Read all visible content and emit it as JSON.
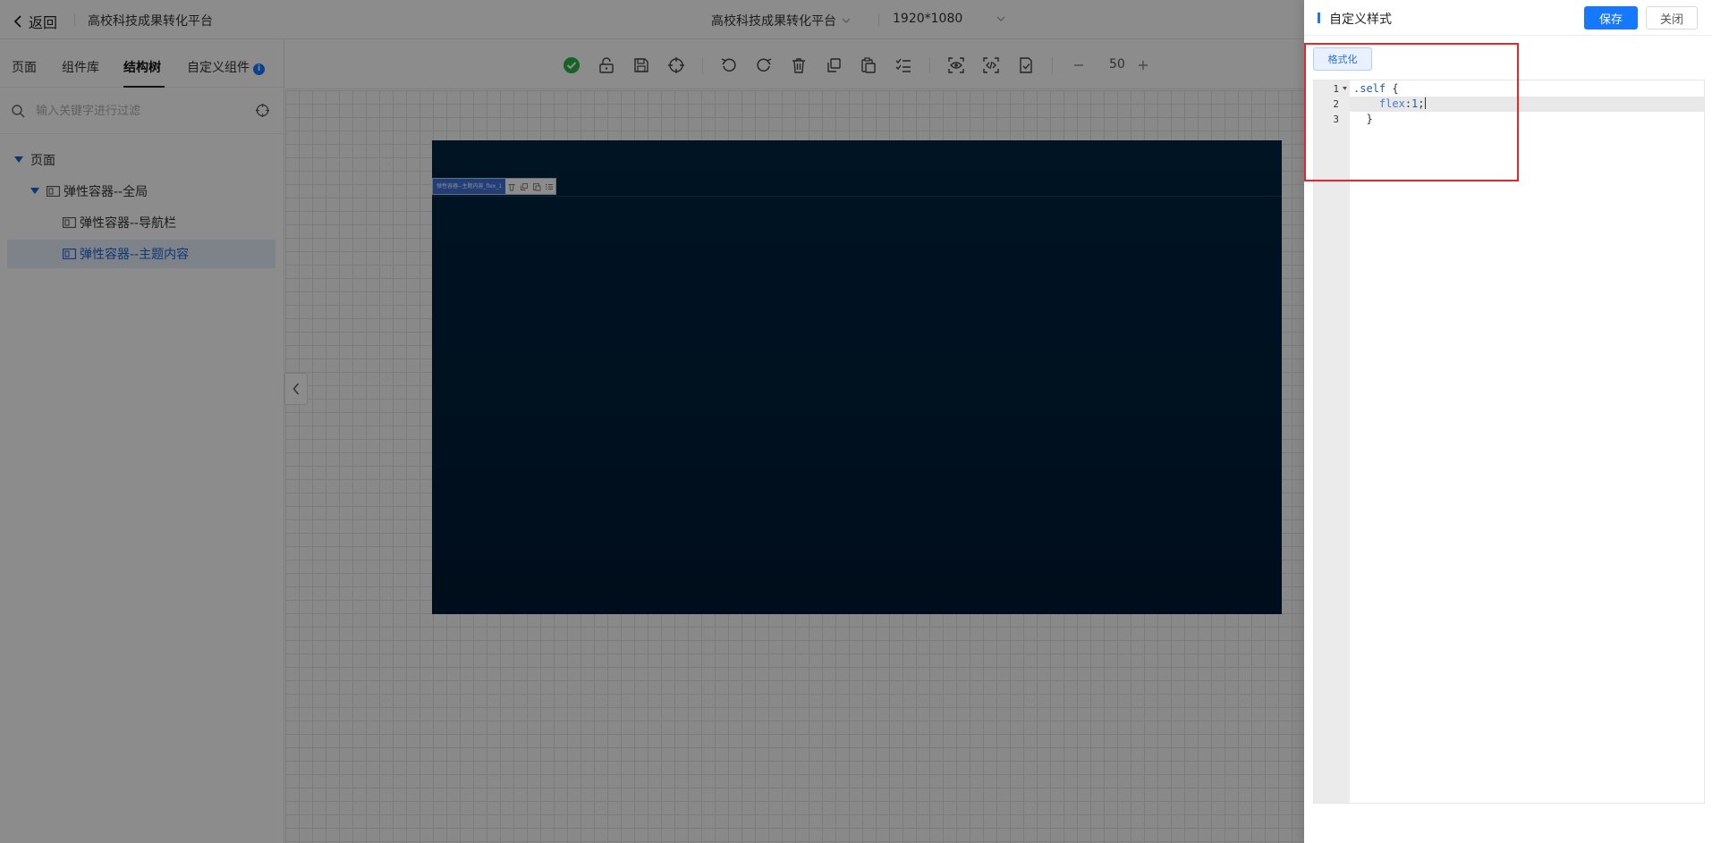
{
  "header": {
    "back_label": "返回",
    "project_title": "高校科技成果转化平台",
    "center_select": "高校科技成果转化平台",
    "resolution": "1920*1080"
  },
  "left_panel": {
    "tabs": [
      {
        "label": "页面"
      },
      {
        "label": "组件库"
      },
      {
        "label": "结构树"
      },
      {
        "label": "自定义组件"
      }
    ],
    "active_tab": "结构树",
    "search_placeholder": "输入关键字进行过滤",
    "tree": [
      {
        "label": "页面",
        "expanded": true
      },
      {
        "label": "弹性容器--全局",
        "expanded": true
      },
      {
        "label": "弹性容器--导航栏"
      },
      {
        "label": "弹性容器--主题内容",
        "selected": true
      }
    ]
  },
  "toolbar": {
    "icons": [
      "check-circle-icon",
      "unlock-icon",
      "save-icon",
      "crosshair-icon",
      "undo-icon",
      "redo-icon",
      "delete-icon",
      "copy-icon",
      "paste-icon",
      "list-icon",
      "preview-icon",
      "code-icon",
      "publish-icon",
      "zoom-out-icon",
      "zoom-in-icon"
    ],
    "zoom": "50",
    "status_color": "#2db34a"
  },
  "canvas": {
    "artboard_colors": [
      "#012542",
      "#011a33"
    ],
    "selection_chip_label": "弹性容器--主题内容_flex_1"
  },
  "drawer": {
    "title": "自定义样式",
    "save_label": "保存",
    "close_label": "关闭",
    "format_label": "格式化",
    "code_lines": [
      {
        "num": "1",
        "selector": ".self",
        "text": " {"
      },
      {
        "num": "2",
        "indent": "    ",
        "prop": "flex",
        "value": "1",
        "punct": ";"
      },
      {
        "num": "3",
        "text": "  }"
      }
    ],
    "accent_color": "#1677ff"
  },
  "annotation": {
    "highlight_color": "#e8262a"
  }
}
